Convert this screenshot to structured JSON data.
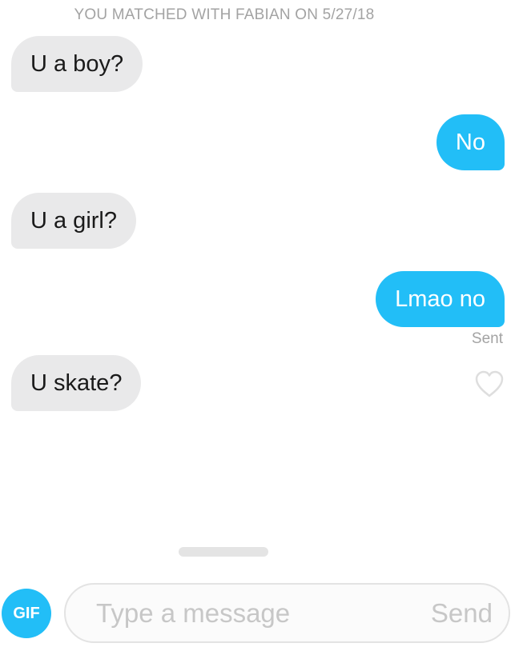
{
  "header": {
    "match_text": "YOU MATCHED WITH FABIAN ON 5/27/18"
  },
  "messages": [
    {
      "direction": "received",
      "text": "U a boy?"
    },
    {
      "direction": "sent",
      "text": "No"
    },
    {
      "direction": "received",
      "text": "U a girl?"
    },
    {
      "direction": "sent",
      "text": "Lmao no"
    },
    {
      "direction": "received",
      "text": "U skate?"
    }
  ],
  "status": {
    "sent_label": "Sent"
  },
  "icons": {
    "like": "heart-outline-icon"
  },
  "composer": {
    "gif_label": "GIF",
    "placeholder": "Type a message",
    "value": "",
    "send_label": "Send"
  },
  "colors": {
    "accent": "#22bef7",
    "received_bubble": "#e9e9ea",
    "muted_text": "#a3a3a3"
  }
}
